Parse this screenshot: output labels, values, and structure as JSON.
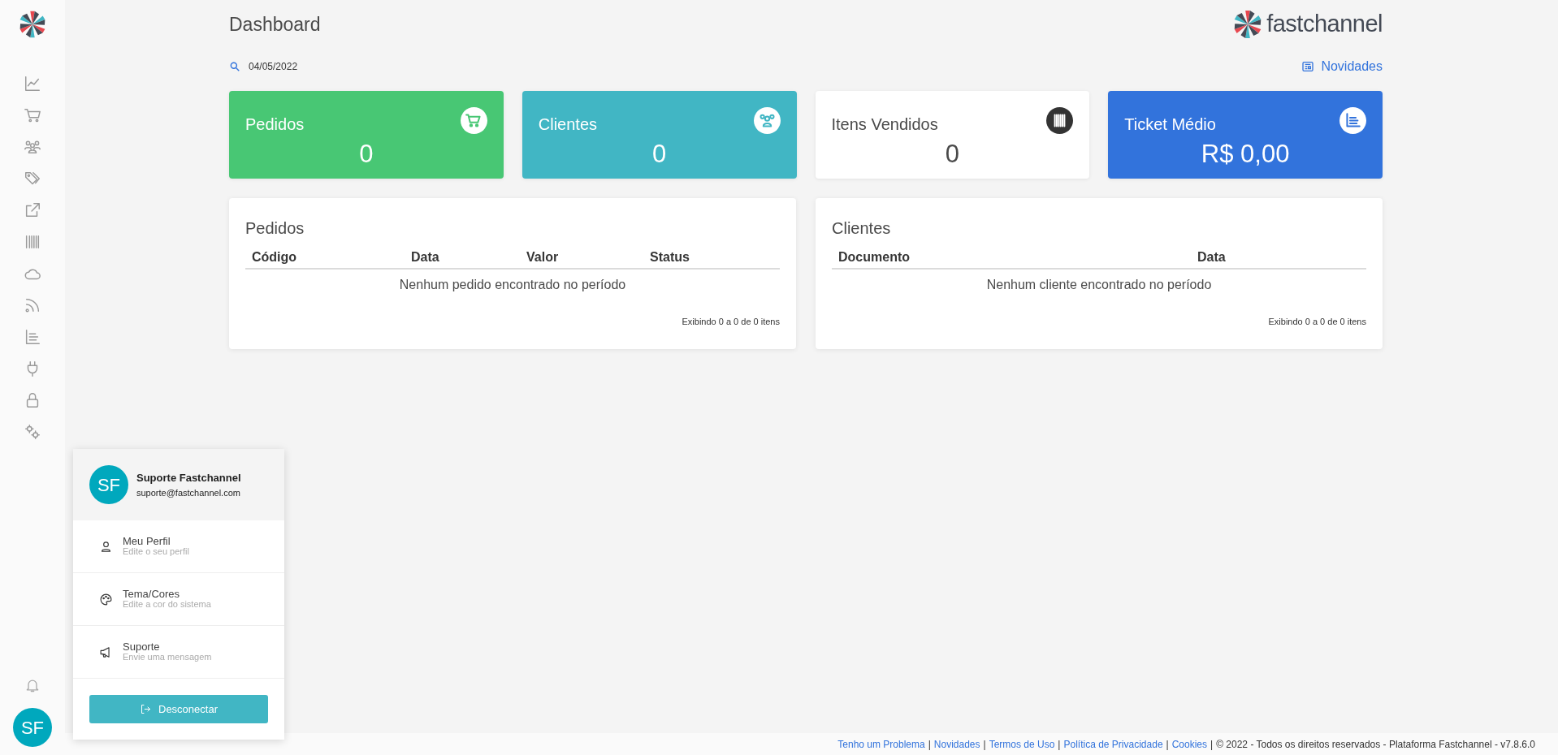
{
  "header": {
    "title": "Dashboard",
    "brand": "fastchannel"
  },
  "filter": {
    "date": "04/05/2022"
  },
  "news_link": "Novidades",
  "stat_cards": [
    {
      "label": "Pedidos",
      "value": "0",
      "color": "#48c774",
      "kind": "cart"
    },
    {
      "label": "Clientes",
      "value": "0",
      "color": "#41b6c4",
      "kind": "users"
    },
    {
      "label": "Itens Vendidos",
      "value": "0",
      "color": "#ffffff",
      "kind": "barcode"
    },
    {
      "label": "Ticket Médio",
      "value": "R$ 0,00",
      "color": "#3273dc",
      "kind": "list"
    }
  ],
  "tables": [
    {
      "title": "Pedidos",
      "columns": [
        "Código",
        "Data",
        "Valor",
        "Status"
      ],
      "empty": "Nenhum pedido encontrado no período",
      "footer": "Exibindo 0 a 0 de 0 itens"
    },
    {
      "title": "Clientes",
      "columns": [
        "Documento",
        "Data"
      ],
      "empty": "Nenhum cliente encontrado no período",
      "footer": "Exibindo 0 a 0 de 0 itens"
    }
  ],
  "user_menu": {
    "initials": "SF",
    "name": "Suporte Fastchannel",
    "email": "suporte@fastchannel.com",
    "items": [
      {
        "kind": "profile",
        "title": "Meu Perfil",
        "subtitle": "Edite o seu perfil"
      },
      {
        "kind": "theme",
        "title": "Tema/Cores",
        "subtitle": "Edite a cor do sistema"
      },
      {
        "kind": "support",
        "title": "Suporte",
        "subtitle": "Envie uma mensagem"
      }
    ],
    "logout": "Desconectar"
  },
  "sidebar": {
    "avatar_initials": "SF"
  },
  "footer": [
    {
      "kind": "link",
      "text": "Tenho um Problema"
    },
    {
      "kind": "sep",
      "text": "|"
    },
    {
      "kind": "link",
      "text": "Novidades"
    },
    {
      "kind": "sep",
      "text": "|"
    },
    {
      "kind": "link",
      "text": "Termos de Uso"
    },
    {
      "kind": "sep",
      "text": "|"
    },
    {
      "kind": "link",
      "text": "Política de Privacidade"
    },
    {
      "kind": "sep",
      "text": "|"
    },
    {
      "kind": "link",
      "text": "Cookies"
    },
    {
      "kind": "sep",
      "text": "|"
    },
    {
      "kind": "text",
      "text": "© 2022 - Todos os direitos reservados - Plataforma Fastchannel - v7.8.6.0"
    }
  ]
}
